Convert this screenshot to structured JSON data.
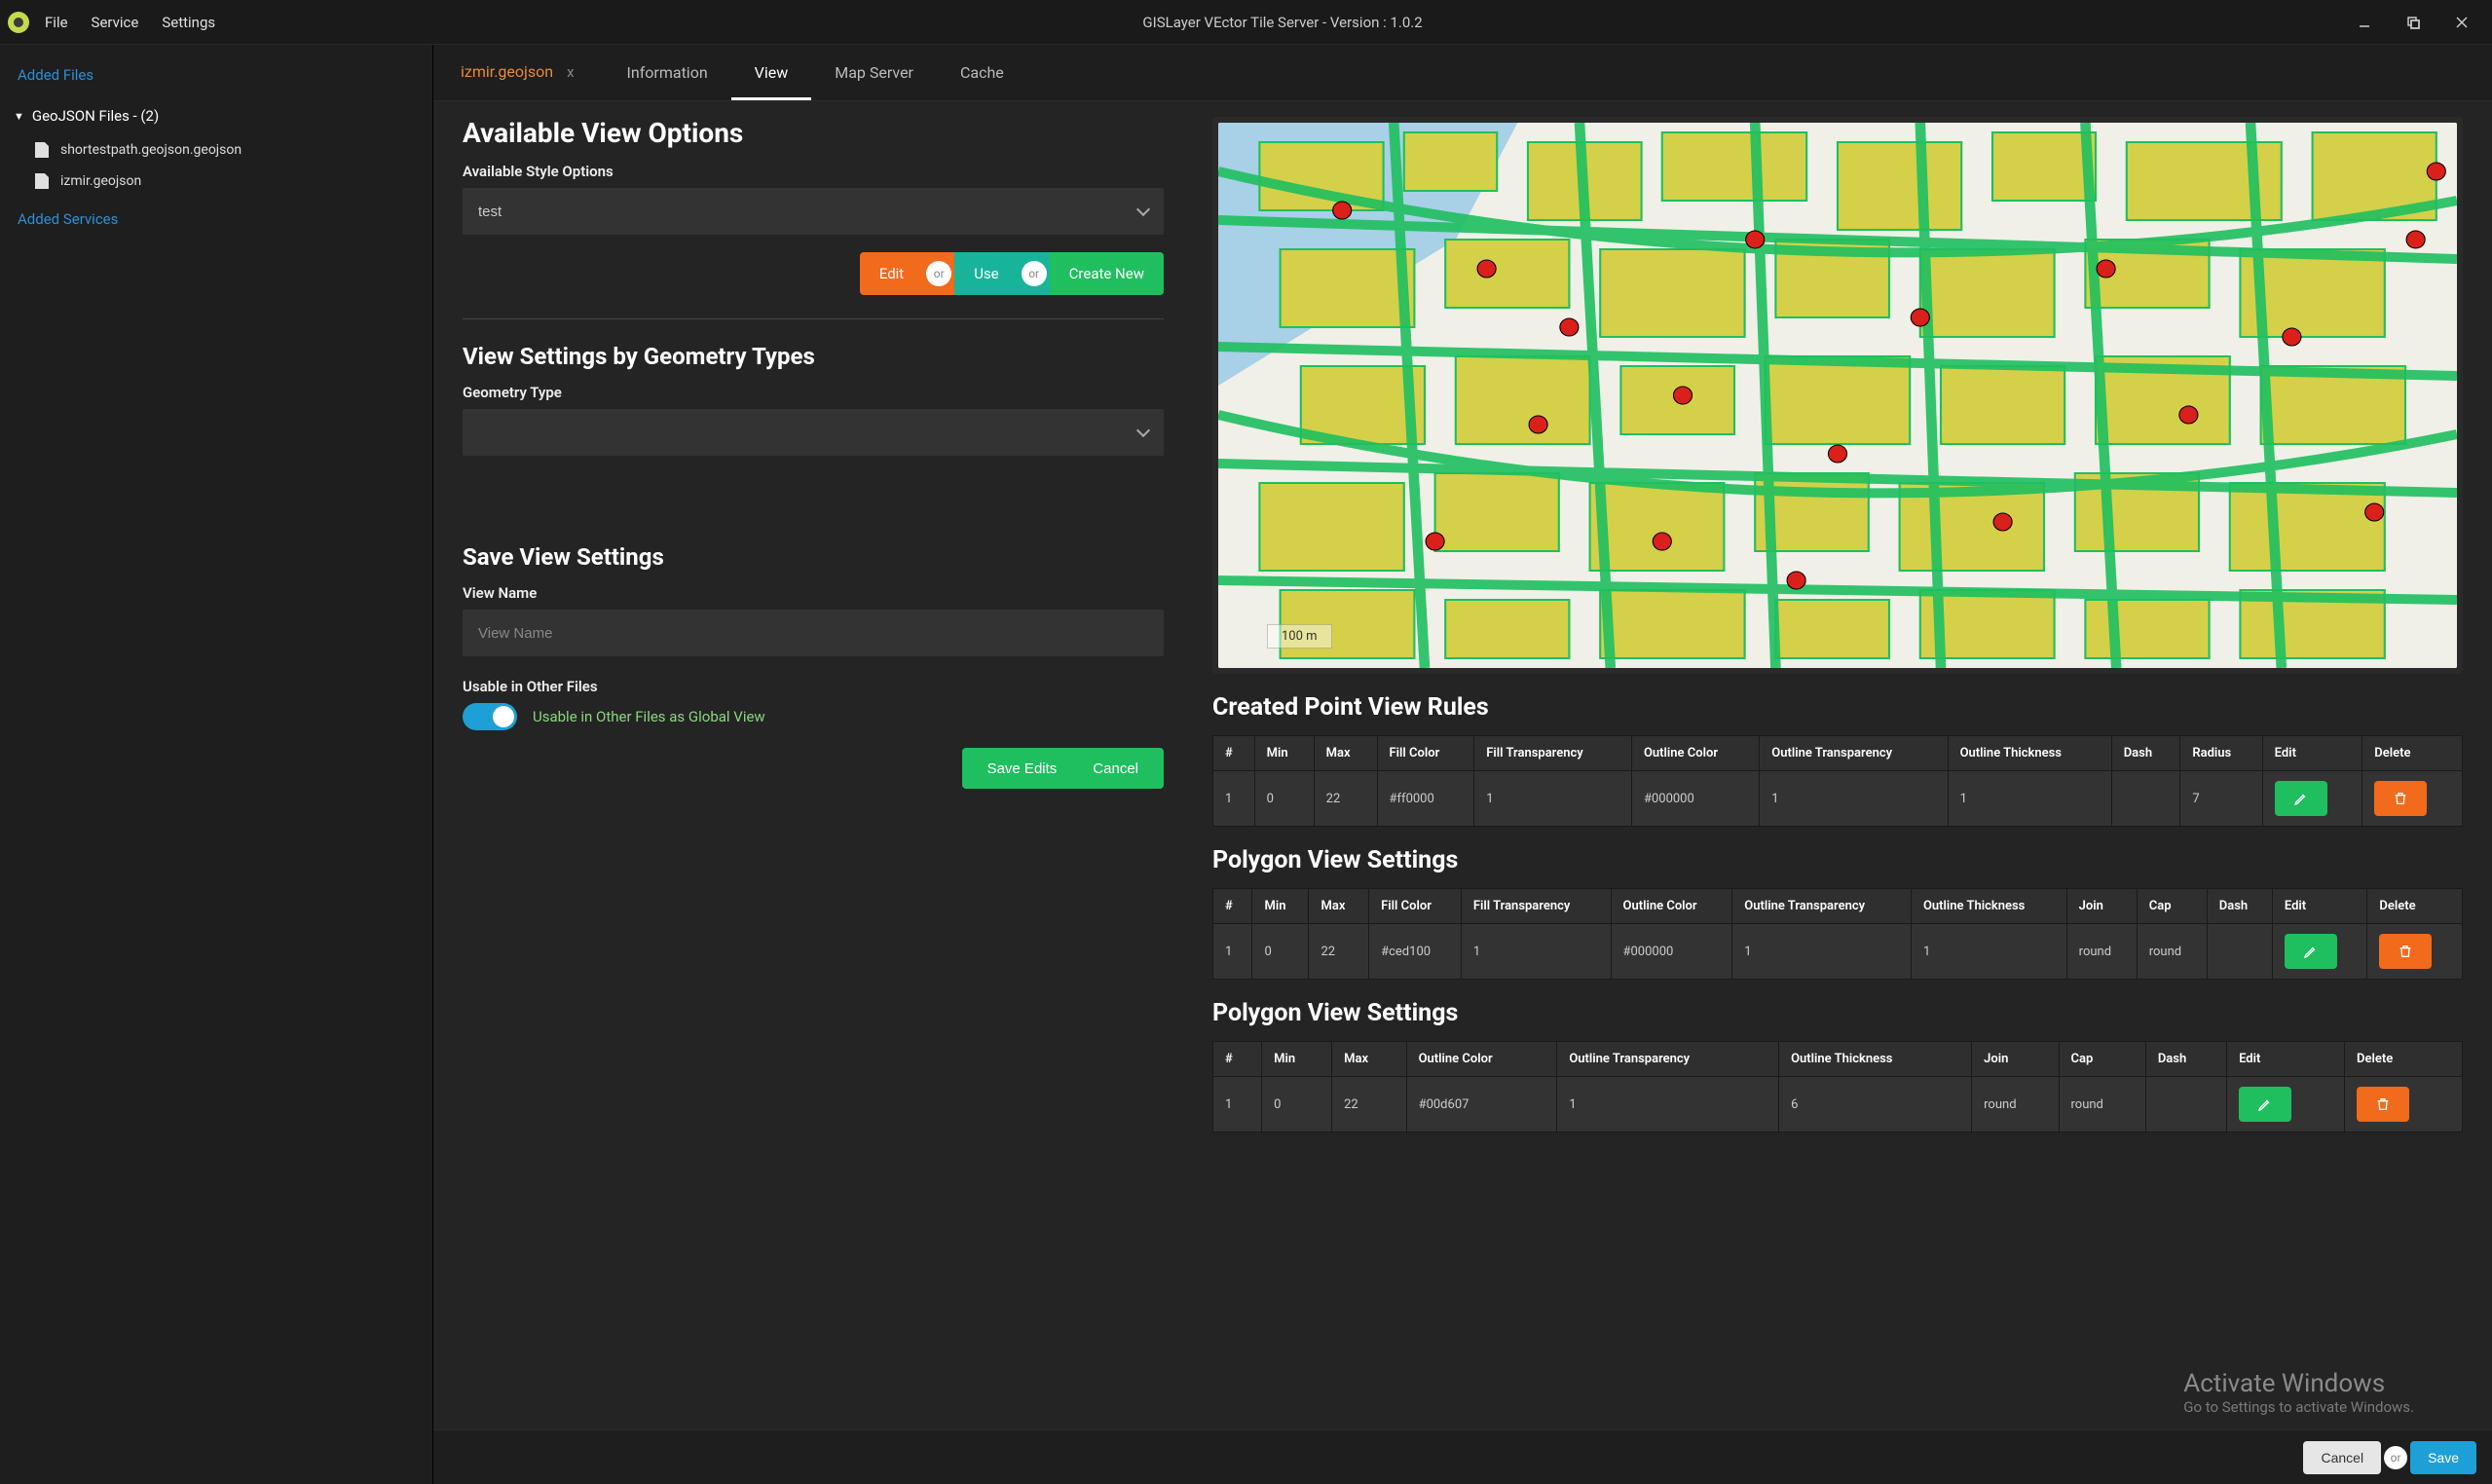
{
  "app": {
    "title": "GISLayer VEctor Tile Server - Version : 1.0.2",
    "menus": [
      "File",
      "Service",
      "Settings"
    ]
  },
  "sidebar": {
    "added_files": "Added Files",
    "tree_header": "GeoJSON Files - (2)",
    "files": [
      {
        "name": "shortestpath.geojson.geojson"
      },
      {
        "name": "izmir.geojson"
      }
    ],
    "added_services": "Added Services"
  },
  "file_tab": {
    "name": "izmir.geojson",
    "close": "x"
  },
  "inner_tabs": [
    "Information",
    "View",
    "Map Server",
    "Cache"
  ],
  "active_inner_tab": "View",
  "view_options": {
    "heading": "Available View Options",
    "style_label": "Available Style Options",
    "style_value": "test",
    "edit": "Edit",
    "or": "or",
    "use": "Use",
    "create_new": "Create New"
  },
  "geom": {
    "heading": "View Settings by Geometry Types",
    "label": "Geometry Type",
    "value": ""
  },
  "save_view": {
    "heading": "Save View Settings",
    "name_label": "View Name",
    "name_placeholder": "View Name",
    "usable_label": "Usable in Other Files",
    "toggle_label": "Usable in Other Files as Global View",
    "save_edits": "Save Edits",
    "cancel": "Cancel"
  },
  "map": {
    "scale": "100 m"
  },
  "point_rules": {
    "heading": "Created Point View Rules",
    "cols": [
      "#",
      "Min",
      "Max",
      "Fill Color",
      "Fill Transparency",
      "Outline Color",
      "Outline Transparency",
      "Outline Thickness",
      "Dash",
      "Radius",
      "Edit",
      "Delete"
    ],
    "rows": [
      {
        "n": "1",
        "min": "0",
        "max": "22",
        "fill": "#ff0000",
        "ft": "1",
        "oc": "#000000",
        "ot": "1",
        "oth": "1",
        "dash": "",
        "radius": "7"
      }
    ]
  },
  "poly1": {
    "heading": "Polygon View Settings",
    "cols": [
      "#",
      "Min",
      "Max",
      "Fill Color",
      "Fill Transparency",
      "Outline Color",
      "Outline Transparency",
      "Outline Thickness",
      "Join",
      "Cap",
      "Dash",
      "Edit",
      "Delete"
    ],
    "rows": [
      {
        "n": "1",
        "min": "0",
        "max": "22",
        "fill": "#ced100",
        "ft": "1",
        "oc": "#000000",
        "ot": "1",
        "oth": "1",
        "join": "round",
        "cap": "round",
        "dash": ""
      }
    ]
  },
  "poly2": {
    "heading": "Polygon View Settings",
    "cols": [
      "#",
      "Min",
      "Max",
      "Outline Color",
      "Outline Transparency",
      "Outline Thickness",
      "Join",
      "Cap",
      "Dash",
      "Edit",
      "Delete"
    ],
    "rows": [
      {
        "n": "1",
        "min": "0",
        "max": "22",
        "oc": "#00d607",
        "ot": "1",
        "oth": "6",
        "join": "round",
        "cap": "round",
        "dash": ""
      }
    ]
  },
  "footer": {
    "cancel": "Cancel",
    "or": "or",
    "save": "Save"
  },
  "watermark": {
    "line1": "Activate Windows",
    "line2": "Go to Settings to activate Windows."
  }
}
